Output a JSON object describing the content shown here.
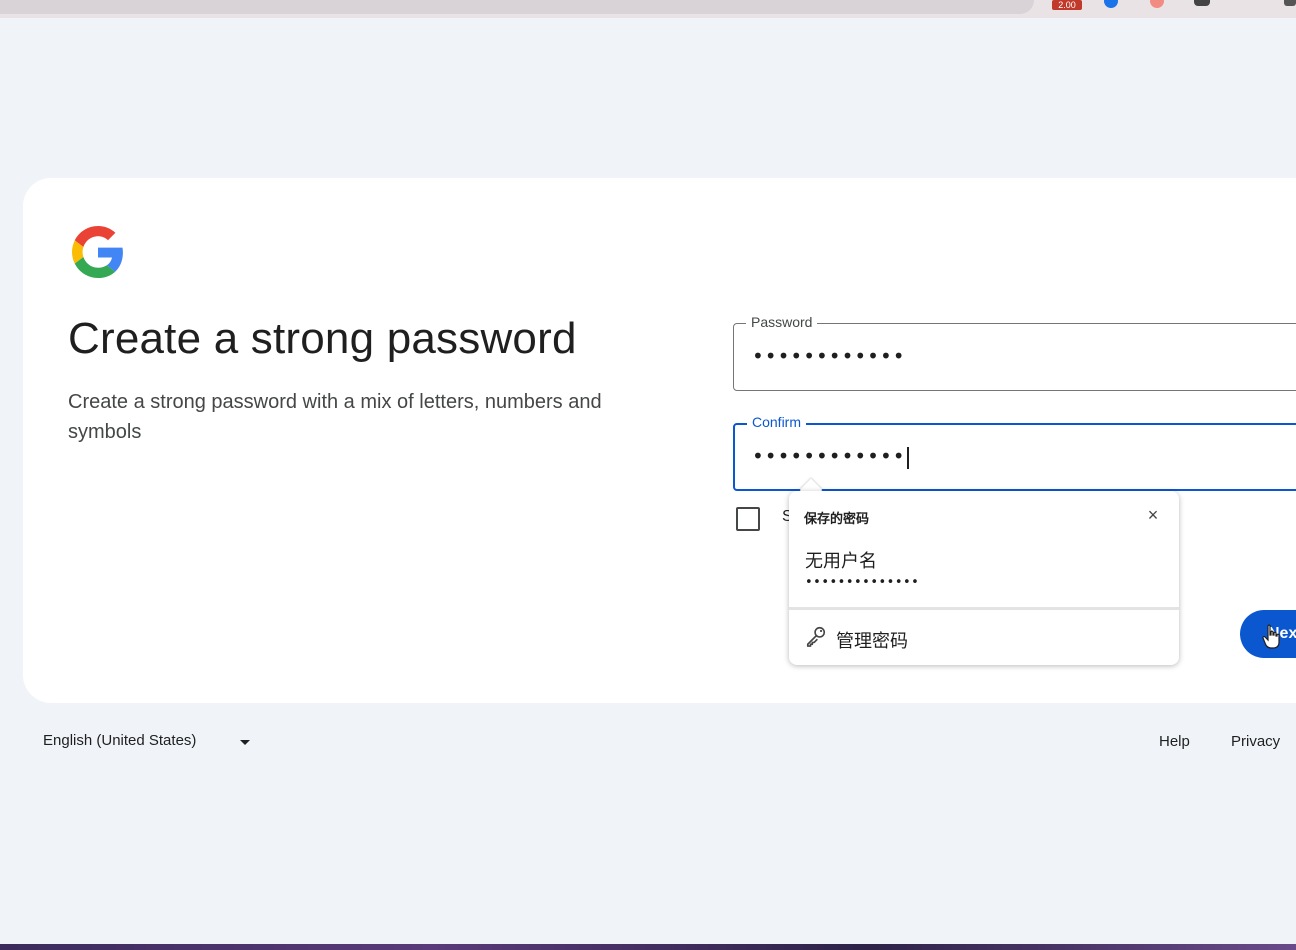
{
  "browser": {
    "extension_badge": "2.00"
  },
  "logo": {
    "icon": "google-g-icon",
    "colors": [
      "#4285f4",
      "#ea4335",
      "#fbbc05",
      "#34a853"
    ]
  },
  "header": {
    "title": "Create a strong password",
    "subtitle": "Create a strong password with a mix of letters, numbers and symbols"
  },
  "form": {
    "password": {
      "label": "Password",
      "value": "••••••••••••"
    },
    "confirm": {
      "label": "Confirm",
      "value": "••••••••••••"
    },
    "show_password_label": "S",
    "next_label": "Next"
  },
  "autofill_popup": {
    "title": "保存的密码",
    "close_icon": "close-icon",
    "entry": {
      "username": "无用户名",
      "password": "••••••••••••••"
    },
    "manage_label": "管理密码",
    "manage_icon": "key-icon"
  },
  "footer": {
    "language": "English (United States)",
    "help": "Help",
    "privacy": "Privacy"
  },
  "colors": {
    "background": "#f0f4f9",
    "accent": "#0b57d0"
  }
}
